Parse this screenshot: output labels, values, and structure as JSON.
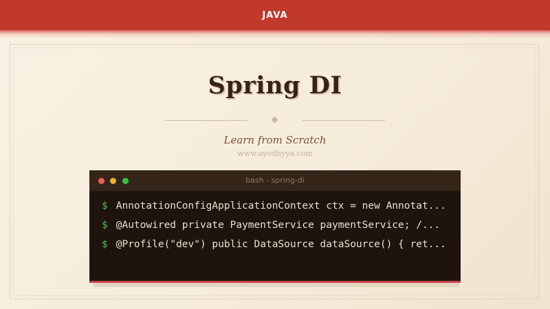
{
  "header": {
    "label": "JAVA"
  },
  "hero": {
    "title": "Spring DI",
    "subtitle": "Learn from Scratch",
    "site": "www.ayodhyya.com"
  },
  "terminal": {
    "title": "bash - spring-di",
    "prompt": "$",
    "lines": [
      "AnnotationConfigApplicationContext ctx = new Annotat...",
      "@Autowired private PaymentService paymentService;  /...",
      "@Profile(\"dev\") public DataSource dataSource() { ret..."
    ]
  },
  "colors": {
    "accent": "#c0392b",
    "terminal_bg": "#1f140d",
    "prompt": "#4bbf52"
  }
}
